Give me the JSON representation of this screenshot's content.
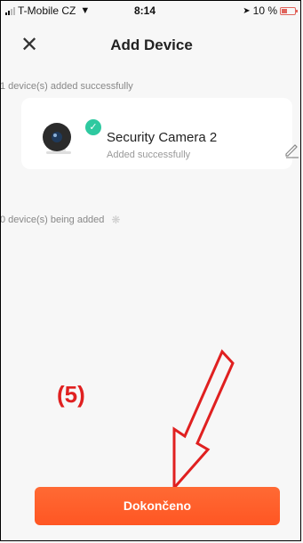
{
  "status_bar": {
    "carrier": "T-Mobile CZ",
    "time": "8:14",
    "battery": "10 %"
  },
  "nav": {
    "title": "Add Device"
  },
  "added_section": {
    "label": "1 device(s) added successfully"
  },
  "devices": [
    {
      "name": "Security Camera 2",
      "status": "Added successfully"
    }
  ],
  "adding_section": {
    "label": "0 device(s) being added"
  },
  "annotation": {
    "text": "(5)"
  },
  "actions": {
    "done_label": "Dokončeno"
  },
  "colors": {
    "accent": "#ff5e2b",
    "success": "#2ec9a0",
    "annotation": "#e02020"
  }
}
